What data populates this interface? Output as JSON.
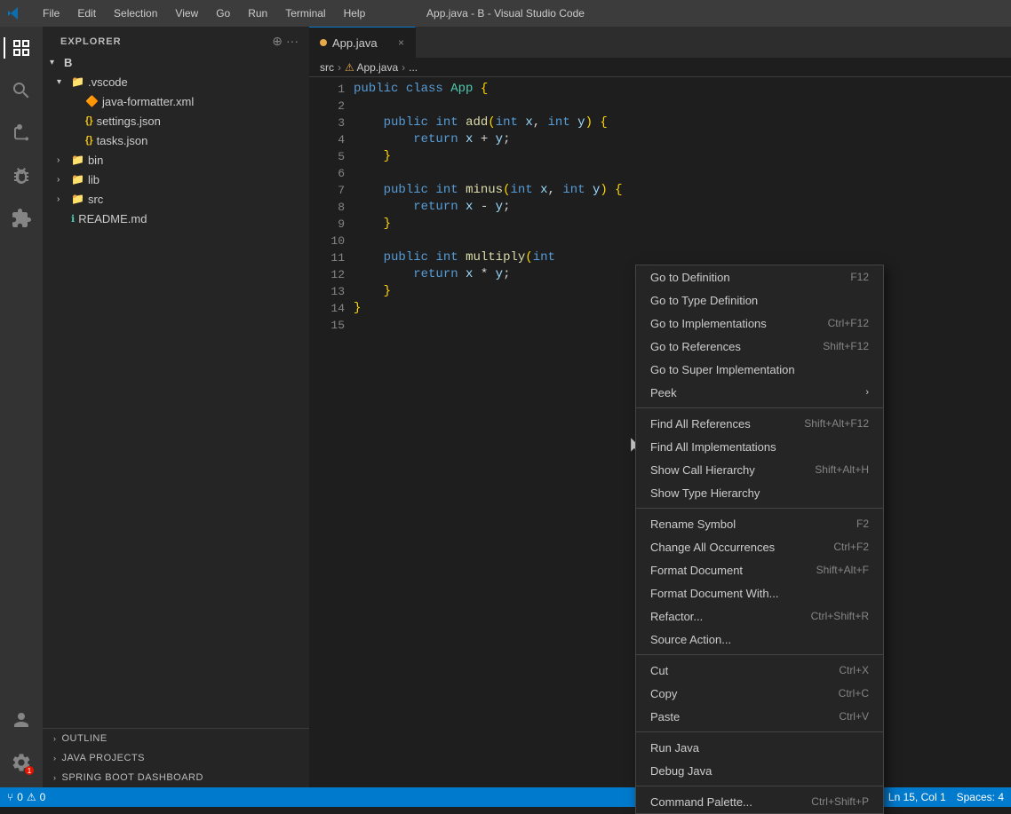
{
  "window": {
    "title": "App.java - B - Visual Studio Code"
  },
  "menubar": {
    "items": [
      {
        "label": "File",
        "id": "file"
      },
      {
        "label": "Edit",
        "id": "edit"
      },
      {
        "label": "Selection",
        "id": "selection"
      },
      {
        "label": "View",
        "id": "view"
      },
      {
        "label": "Go",
        "id": "go"
      },
      {
        "label": "Run",
        "id": "run"
      },
      {
        "label": "Terminal",
        "id": "terminal"
      },
      {
        "label": "Help",
        "id": "help"
      }
    ]
  },
  "sidebar": {
    "title": "EXPLORER",
    "tree": [
      {
        "id": "b",
        "label": "B",
        "level": 0,
        "type": "folder",
        "expanded": true,
        "chevron": "▾"
      },
      {
        "id": "vscode",
        "label": ".vscode",
        "level": 1,
        "type": "folder",
        "expanded": true,
        "chevron": "▾"
      },
      {
        "id": "java-formatter",
        "label": "java-formatter.xml",
        "level": 2,
        "type": "xml",
        "icon": "🔶"
      },
      {
        "id": "settings",
        "label": "settings.json",
        "level": 2,
        "type": "json",
        "icon": "{}"
      },
      {
        "id": "tasks",
        "label": "tasks.json",
        "level": 2,
        "type": "json",
        "icon": "{}"
      },
      {
        "id": "bin",
        "label": "bin",
        "level": 1,
        "type": "folder",
        "expanded": false,
        "chevron": "›"
      },
      {
        "id": "lib",
        "label": "lib",
        "level": 1,
        "type": "folder",
        "expanded": false,
        "chevron": "›"
      },
      {
        "id": "src",
        "label": "src",
        "level": 1,
        "type": "folder",
        "expanded": false,
        "chevron": "›"
      },
      {
        "id": "readme",
        "label": "README.md",
        "level": 1,
        "type": "md",
        "icon": "ℹ"
      }
    ]
  },
  "tab": {
    "filename": "App.java",
    "modified": true,
    "close_label": "×"
  },
  "breadcrumb": {
    "parts": [
      "src",
      ">",
      "⚠ App.java",
      ">",
      "..."
    ]
  },
  "code": {
    "lines": [
      {
        "num": 1,
        "content": "public class App {"
      },
      {
        "num": 2,
        "content": ""
      },
      {
        "num": 3,
        "content": "    public int add(int x, int y) {"
      },
      {
        "num": 4,
        "content": "        return x + y;"
      },
      {
        "num": 5,
        "content": "    }"
      },
      {
        "num": 6,
        "content": ""
      },
      {
        "num": 7,
        "content": "    public int minus(int x, int y) {"
      },
      {
        "num": 8,
        "content": "        return x - y;"
      },
      {
        "num": 9,
        "content": "    }"
      },
      {
        "num": 10,
        "content": ""
      },
      {
        "num": 11,
        "content": "    public int multiply(int"
      },
      {
        "num": 12,
        "content": "        return x * y;"
      },
      {
        "num": 13,
        "content": "    }"
      },
      {
        "num": 14,
        "content": "}"
      },
      {
        "num": 15,
        "content": ""
      }
    ]
  },
  "context_menu": {
    "items": [
      {
        "id": "goto-def",
        "label": "Go to Definition",
        "shortcut": "F12",
        "separator_before": false
      },
      {
        "id": "goto-type-def",
        "label": "Go to Type Definition",
        "shortcut": "",
        "separator_before": false
      },
      {
        "id": "goto-impl",
        "label": "Go to Implementations",
        "shortcut": "Ctrl+F12",
        "separator_before": false
      },
      {
        "id": "goto-refs",
        "label": "Go to References",
        "shortcut": "Shift+F12",
        "separator_before": false
      },
      {
        "id": "goto-super",
        "label": "Go to Super Implementation",
        "shortcut": "",
        "separator_before": false
      },
      {
        "id": "peek",
        "label": "Peek",
        "shortcut": "",
        "has_submenu": true,
        "separator_before": false
      },
      {
        "id": "sep1",
        "type": "separator"
      },
      {
        "id": "find-refs",
        "label": "Find All References",
        "shortcut": "Shift+Alt+F12",
        "separator_before": false
      },
      {
        "id": "find-impl",
        "label": "Find All Implementations",
        "shortcut": "",
        "separator_before": false
      },
      {
        "id": "show-call",
        "label": "Show Call Hierarchy",
        "shortcut": "Shift+Alt+H",
        "separator_before": false
      },
      {
        "id": "show-type",
        "label": "Show Type Hierarchy",
        "shortcut": "",
        "separator_before": false
      },
      {
        "id": "sep2",
        "type": "separator"
      },
      {
        "id": "rename",
        "label": "Rename Symbol",
        "shortcut": "F2",
        "separator_before": false,
        "highlighted": false
      },
      {
        "id": "change-all",
        "label": "Change All Occurrences",
        "shortcut": "Ctrl+F2",
        "separator_before": false
      },
      {
        "id": "format-doc",
        "label": "Format Document",
        "shortcut": "Shift+Alt+F",
        "separator_before": false
      },
      {
        "id": "format-with",
        "label": "Format Document With...",
        "shortcut": "",
        "separator_before": false
      },
      {
        "id": "refactor",
        "label": "Refactor...",
        "shortcut": "Ctrl+Shift+R",
        "separator_before": false
      },
      {
        "id": "source-action",
        "label": "Source Action...",
        "shortcut": "",
        "separator_before": false
      },
      {
        "id": "sep3",
        "type": "separator"
      },
      {
        "id": "cut",
        "label": "Cut",
        "shortcut": "Ctrl+X",
        "separator_before": false
      },
      {
        "id": "copy",
        "label": "Copy",
        "shortcut": "Ctrl+C",
        "separator_before": false
      },
      {
        "id": "paste",
        "label": "Paste",
        "shortcut": "Ctrl+V",
        "separator_before": false
      },
      {
        "id": "sep4",
        "type": "separator"
      },
      {
        "id": "run-java",
        "label": "Run Java",
        "shortcut": "",
        "separator_before": false
      },
      {
        "id": "debug-java",
        "label": "Debug Java",
        "shortcut": "",
        "separator_before": false
      },
      {
        "id": "sep5",
        "type": "separator"
      },
      {
        "id": "command-palette",
        "label": "Command Palette...",
        "shortcut": "Ctrl+Shift+P",
        "separator_before": false
      }
    ]
  },
  "bottom_panels": [
    {
      "id": "outline",
      "label": "OUTLINE"
    },
    {
      "id": "java-projects",
      "label": "JAVA PROJECTS"
    },
    {
      "id": "spring-boot",
      "label": "SPRING BOOT DASHBOARD"
    }
  ],
  "status_bar": {
    "left": [
      {
        "id": "git",
        "label": "⑂ 0  ⚠ 0"
      },
      {
        "id": "errors",
        "label": "⚠ 0"
      }
    ],
    "right": [
      {
        "id": "position",
        "label": "Ln 15, Col 1"
      },
      {
        "id": "spaces",
        "label": "Spaces: 4"
      }
    ]
  }
}
